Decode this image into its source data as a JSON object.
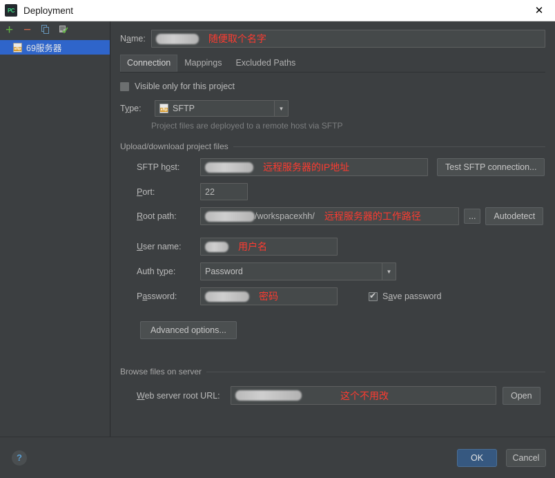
{
  "window": {
    "title": "Deployment",
    "logo_text": "PC",
    "close_icon": "close-icon"
  },
  "sidebar": {
    "toolbar": [
      {
        "name": "add-button",
        "glyph": "+"
      },
      {
        "name": "remove-button",
        "glyph": "−"
      },
      {
        "name": "copy-button",
        "glyph": "❐"
      },
      {
        "name": "set-default-button",
        "glyph": "✓"
      }
    ],
    "items": [
      {
        "label": "69服务器",
        "icon": "sftp-icon",
        "selected": true
      }
    ]
  },
  "name_row": {
    "label": "Name:",
    "value": "",
    "annotation": "随便取个名字"
  },
  "tabs": [
    {
      "label": "Connection",
      "active": true
    },
    {
      "label": "Mappings",
      "active": false
    },
    {
      "label": "Excluded Paths",
      "active": false
    }
  ],
  "connection": {
    "visible_only_checkbox": {
      "label": "Visible only for this project",
      "checked": false
    },
    "type": {
      "label": "Type:",
      "value": "SFTP",
      "icon": "sftp-icon"
    },
    "type_hint": "Project files are deployed to a remote host via SFTP",
    "upload_group": "Upload/download project files",
    "sftp_host": {
      "label": "SFTP host:",
      "value": "",
      "annotation": "远程服务器的IP地址"
    },
    "test_connection_button": "Test SFTP connection...",
    "port": {
      "label": "Port:",
      "value": "22"
    },
    "root_path": {
      "label": "Root path:",
      "value": "/workspacexhh/",
      "annotation": "远程服务器的工作路径"
    },
    "browse_button": "...",
    "autodetect_button": "Autodetect",
    "user_name": {
      "label": "User name:",
      "value": "",
      "annotation": "用户名"
    },
    "auth_type": {
      "label": "Auth type:",
      "value": "Password"
    },
    "password": {
      "label": "Password:",
      "value": "",
      "annotation": "密码"
    },
    "save_password_checkbox": {
      "label": "Save password",
      "checked": true
    },
    "advanced_options_button": "Advanced options...",
    "browse_group": "Browse files on server",
    "web_server_root_url": {
      "label": "Web server root URL:",
      "value": "",
      "annotation": "这个不用改"
    },
    "open_button": "Open"
  },
  "footer": {
    "help_icon": "?",
    "ok_label": "OK",
    "cancel_label": "Cancel"
  },
  "colors": {
    "window_bg": "#3c3f41",
    "field_bg": "#45494a",
    "selection": "#2f65ca",
    "accent_ok": "#365880",
    "annotation_red": "#ff3b30",
    "add_green": "#62b543",
    "remove_red": "#cf6a4c"
  }
}
